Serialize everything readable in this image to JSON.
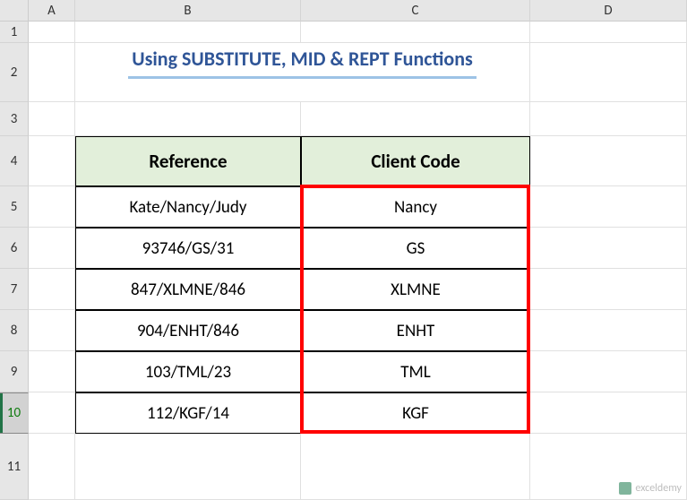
{
  "columns": [
    "A",
    "B",
    "C",
    "D"
  ],
  "rows": [
    "1",
    "2",
    "3",
    "4",
    "5",
    "6",
    "7",
    "8",
    "9",
    "10",
    "11"
  ],
  "selected_row": "10",
  "title": "Using SUBSTITUTE, MID & REPT Functions",
  "table": {
    "headers": [
      "Reference",
      "Client Code"
    ],
    "data": [
      [
        "Kate/Nancy/Judy",
        "Nancy"
      ],
      [
        "93746/GS/31",
        "GS"
      ],
      [
        "847/XLMNE/846",
        "XLMNE"
      ],
      [
        "904/ENHT/846",
        "ENHT"
      ],
      [
        "103/TML/23",
        "TML"
      ],
      [
        "112/KGF/14",
        "KGF"
      ]
    ]
  },
  "watermark": "exceldemy"
}
